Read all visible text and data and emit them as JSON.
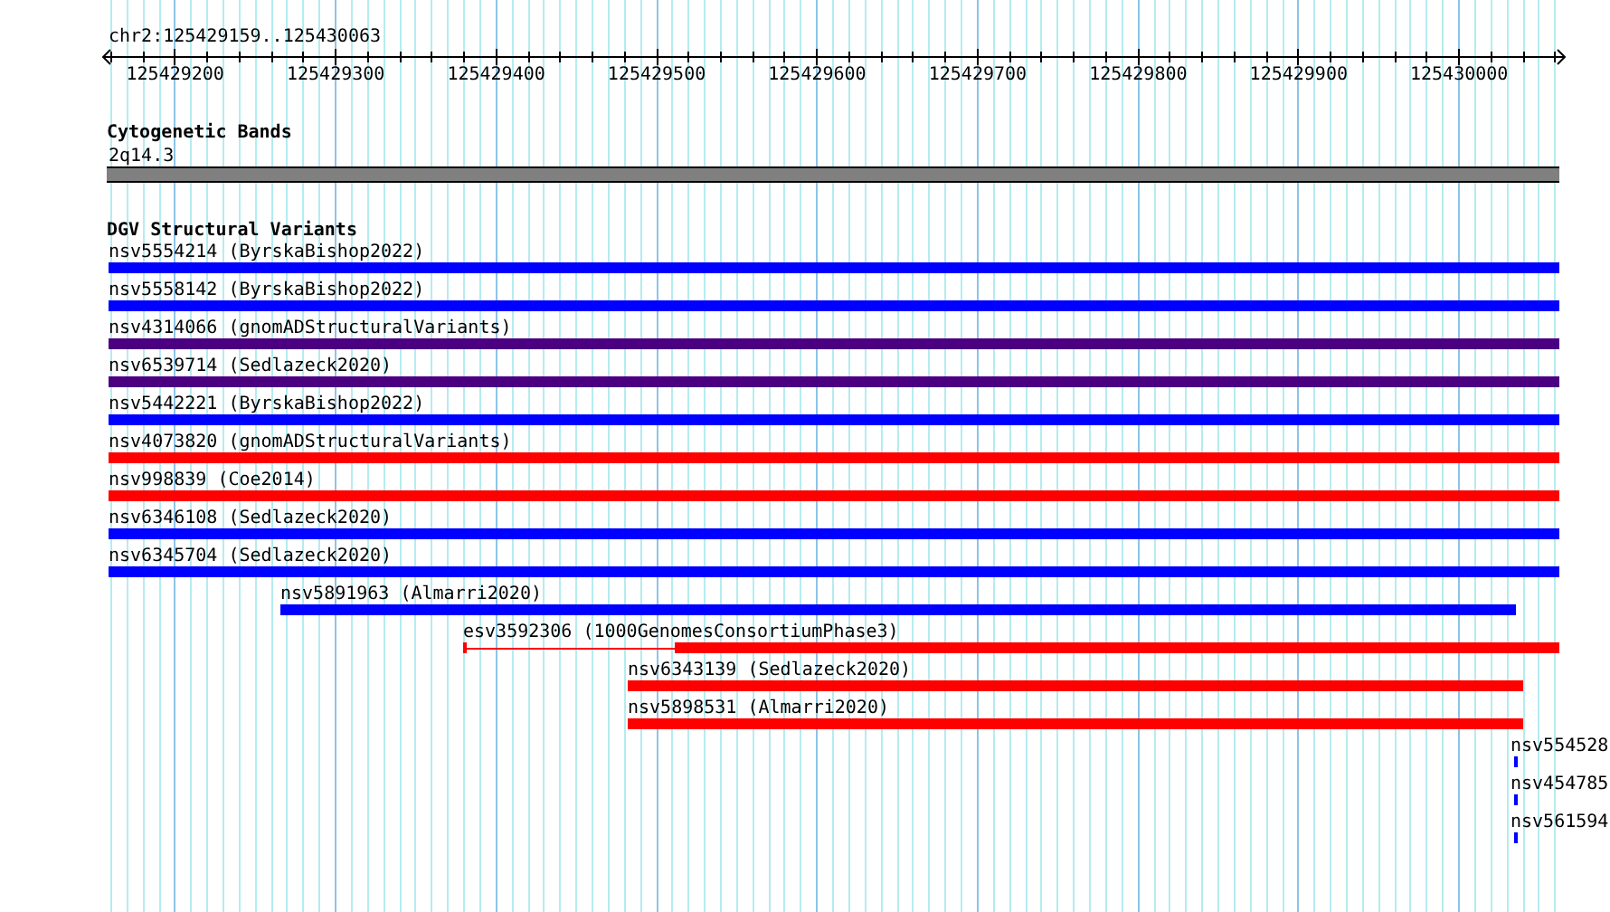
{
  "ruler": {
    "location": "chr2:125429159..125430063",
    "ticks": [
      "125429200",
      "125429300",
      "125429400",
      "125429500",
      "125429600",
      "125429700",
      "125429800",
      "125429900",
      "125430000"
    ]
  },
  "tracks": [
    {
      "title": "Cytogenetic Bands",
      "kind": "cytoband",
      "features": [
        {
          "label": "2q14.3"
        }
      ]
    },
    {
      "title": "DGV Structural Variants",
      "kind": "variants",
      "features": [
        {
          "label": "nsv5554214 (ByrskaBishop2022)",
          "color": "#0000ff",
          "kind": "solid"
        },
        {
          "label": "nsv5558142 (ByrskaBishop2022)",
          "color": "#0000ff",
          "kind": "solid"
        },
        {
          "label": "nsv4314066 (gnomADStructuralVariants)",
          "color": "#4b0082",
          "kind": "solid"
        },
        {
          "label": "nsv6539714 (Sedlazeck2020)",
          "color": "#4b0082",
          "kind": "solid"
        },
        {
          "label": "nsv5442221 (ByrskaBishop2022)",
          "color": "#0000ff",
          "kind": "solid"
        },
        {
          "label": "nsv4073820 (gnomADStructuralVariants)",
          "color": "#ff0000",
          "kind": "solid"
        },
        {
          "label": "nsv998839 (Coe2014)",
          "color": "#ff0000",
          "kind": "solid"
        },
        {
          "label": "nsv6346108 (Sedlazeck2020)",
          "color": "#0000ff",
          "kind": "solid"
        },
        {
          "label": "nsv6345704 (Sedlazeck2020)",
          "color": "#0000ff",
          "kind": "solid"
        },
        {
          "label": "nsv5891963 (Almarri2020)",
          "color": "#0000ff",
          "kind": "solid"
        },
        {
          "label": "esv3592306 (1000GenomesConsortiumPhase3)",
          "color": "#ff0000",
          "kind": "split"
        },
        {
          "label": "nsv6343139 (Sedlazeck2020)",
          "color": "#ff0000",
          "kind": "solid"
        },
        {
          "label": "nsv5898531 (Almarri2020)",
          "color": "#ff0000",
          "kind": "solid"
        },
        {
          "label": "nsv554528",
          "color": "#0000ff",
          "kind": "solid"
        },
        {
          "label": "nsv454785",
          "color": "#0000ff",
          "kind": "solid"
        },
        {
          "label": "nsv561594",
          "color": "#0000ff",
          "kind": "solid"
        }
      ]
    }
  ]
}
